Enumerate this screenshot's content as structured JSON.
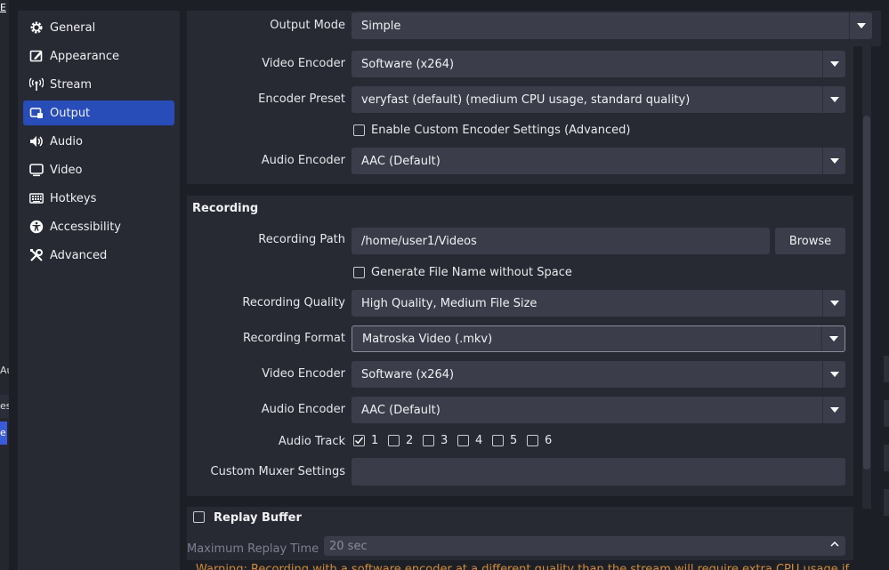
{
  "background": {
    "left_frag_1": "E",
    "left_frag_2": "Au",
    "left_frag_3": "es",
    "left_frag_4": "e"
  },
  "sidebar": {
    "items": [
      {
        "label": "General",
        "icon": "gear-icon",
        "active": false
      },
      {
        "label": "Appearance",
        "icon": "appearance-icon",
        "active": false
      },
      {
        "label": "Stream",
        "icon": "stream-icon",
        "active": false
      },
      {
        "label": "Output",
        "icon": "output-icon",
        "active": true
      },
      {
        "label": "Audio",
        "icon": "speaker-icon",
        "active": false
      },
      {
        "label": "Video",
        "icon": "monitor-icon",
        "active": false
      },
      {
        "label": "Hotkeys",
        "icon": "keyboard-icon",
        "active": false
      },
      {
        "label": "Accessibility",
        "icon": "accessibility-icon",
        "active": false
      },
      {
        "label": "Advanced",
        "icon": "tools-icon",
        "active": false
      }
    ]
  },
  "output_mode": {
    "label": "Output Mode",
    "value": "Simple"
  },
  "streaming": {
    "video_encoder": {
      "label": "Video Encoder",
      "value": "Software (x264)"
    },
    "encoder_preset": {
      "label": "Encoder Preset",
      "value": "veryfast (default) (medium CPU usage, standard quality)"
    },
    "custom_encoder": {
      "label": "Enable Custom Encoder Settings (Advanced)",
      "checked": false
    },
    "audio_encoder": {
      "label": "Audio Encoder",
      "value": "AAC (Default)"
    }
  },
  "recording": {
    "title": "Recording",
    "path": {
      "label": "Recording Path",
      "value": "/home/user1/Videos",
      "browse": "Browse"
    },
    "no_space": {
      "label": "Generate File Name without Space",
      "checked": false
    },
    "quality": {
      "label": "Recording Quality",
      "value": "High Quality, Medium File Size"
    },
    "format": {
      "label": "Recording Format",
      "value": "Matroska Video (.mkv)"
    },
    "video_encoder": {
      "label": "Video Encoder",
      "value": "Software (x264)"
    },
    "audio_encoder": {
      "label": "Audio Encoder",
      "value": "AAC (Default)"
    },
    "audio_track": {
      "label": "Audio Track",
      "tracks": [
        {
          "num": "1",
          "checked": true
        },
        {
          "num": "2",
          "checked": false
        },
        {
          "num": "3",
          "checked": false
        },
        {
          "num": "4",
          "checked": false
        },
        {
          "num": "5",
          "checked": false
        },
        {
          "num": "6",
          "checked": false
        }
      ]
    },
    "muxer": {
      "label": "Custom Muxer Settings",
      "value": ""
    }
  },
  "replay": {
    "label": "Replay Buffer",
    "checked": false,
    "max_time_label": "Maximum Replay Time",
    "max_time_value": "20 sec"
  },
  "warning": "Warning: Recording with a software encoder at a different quality than the stream will require extra CPU usage if you stream",
  "colors": {
    "active": "#284cb8",
    "panel": "#272a33",
    "field": "#3b3e4a",
    "warning": "#d18b3b"
  }
}
